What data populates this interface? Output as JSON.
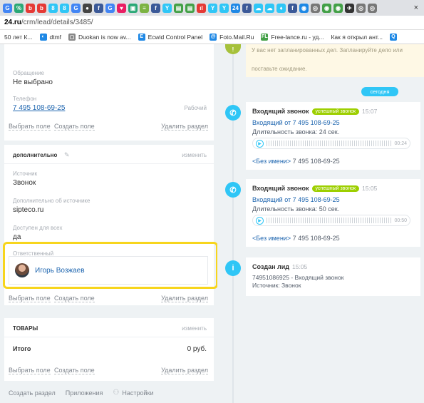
{
  "browser": {
    "tab_favicons": [
      {
        "glyph": "G",
        "color": "#4285f4"
      },
      {
        "glyph": "%",
        "color": "#2aa876"
      },
      {
        "glyph": "b",
        "color": "#e53935"
      },
      {
        "glyph": "b",
        "color": "#e53935"
      },
      {
        "glyph": "8",
        "color": "#2fc6f6"
      },
      {
        "glyph": "8",
        "color": "#2fc6f6"
      },
      {
        "glyph": "G",
        "color": "#4285f4"
      },
      {
        "glyph": "●",
        "color": "#444"
      },
      {
        "glyph": "f",
        "color": "#3b5998"
      },
      {
        "glyph": "G",
        "color": "#4285f4"
      },
      {
        "glyph": "♥",
        "color": "#e91e63"
      },
      {
        "glyph": "▣",
        "color": "#2aa876"
      },
      {
        "glyph": "≡",
        "color": "#7cb342"
      },
      {
        "glyph": "f",
        "color": "#3b5998"
      },
      {
        "glyph": "Y",
        "color": "#2fc6f6"
      },
      {
        "glyph": "▤",
        "color": "#43a047"
      },
      {
        "glyph": "▤",
        "color": "#43a047"
      },
      {
        "glyph": "ıl",
        "color": "#e53935"
      },
      {
        "glyph": "Y",
        "color": "#2fc6f6"
      },
      {
        "glyph": "Y",
        "color": "#2fc6f6"
      },
      {
        "glyph": "24",
        "color": "#1e88e5"
      },
      {
        "glyph": "f",
        "color": "#3b5998"
      },
      {
        "glyph": "☁",
        "color": "#2fc6f6"
      },
      {
        "glyph": "☁",
        "color": "#2fc6f6"
      },
      {
        "glyph": "♦",
        "color": "#2fc6f6"
      },
      {
        "glyph": "f",
        "color": "#3b5998"
      },
      {
        "glyph": "◉",
        "color": "#1e88e5"
      },
      {
        "glyph": "◎",
        "color": "#777"
      },
      {
        "glyph": "◉",
        "color": "#43a047"
      },
      {
        "glyph": "◉",
        "color": "#43a047"
      },
      {
        "glyph": "✈",
        "color": "#333"
      },
      {
        "glyph": "◎",
        "color": "#777"
      },
      {
        "glyph": "◎",
        "color": "#777"
      }
    ],
    "tab_close": "×",
    "url_host": "24.ru",
    "url_path": "/crm/lead/details/3485/",
    "bookmarks": [
      {
        "label": "50 лет К...",
        "icon": "",
        "color": ""
      },
      {
        "label": "dtmf",
        "icon": "◐",
        "color": "#1e88e5"
      },
      {
        "label": "Duokan is now av...",
        "icon": "▢",
        "color": "#888"
      },
      {
        "label": "Ecwid Control Panel",
        "icon": "E",
        "color": "#1e88e5"
      },
      {
        "label": "Foto.Mail.Ru",
        "icon": "@",
        "color": "#1e88e5"
      },
      {
        "label": "Free-lance.ru - уд...",
        "icon": "FL",
        "color": "#43a047"
      },
      {
        "label": "Как я открыл ант...",
        "icon": "",
        "color": ""
      },
      {
        "label": "",
        "icon": "Q",
        "color": "#1e88e5"
      }
    ]
  },
  "lead": {
    "contact": {
      "appeal_label": "Обращение",
      "appeal_value": "Не выбрано",
      "phone_label": "Телефон",
      "phone_value": "7 495 108-69-25",
      "phone_type": "Рабочий",
      "select_field": "Выбрать поле",
      "create_field": "Создать поле",
      "delete_section": "Удалить раздел"
    },
    "additional": {
      "title": "дополнительно",
      "edit": "изменить",
      "source_label": "Источник",
      "source_value": "Звонок",
      "source_info_label": "Дополнительно об источнике",
      "source_info_value": "sipteco.ru",
      "shared_label": "Доступен для всех",
      "shared_value": "да",
      "responsible_label": "Ответственный",
      "responsible_name": "Игорь Возжаев",
      "select_field": "Выбрать поле",
      "create_field": "Создать поле",
      "delete_section": "Удалить раздел"
    },
    "products": {
      "title": "товары",
      "edit": "изменить",
      "total_label": "Итого",
      "total_value": "0 руб.",
      "select_field": "Выбрать поле",
      "create_field": "Создать поле",
      "delete_section": "Удалить раздел"
    },
    "footer": {
      "create_section": "Создать раздел",
      "apps": "Приложения",
      "settings": "Настройки"
    }
  },
  "timeline": {
    "pending_text_1": "У вас нет запланированных дел. Запланируйте дело или",
    "pending_text_2": "поставьте ожидание.",
    "today": "сегодня",
    "calls": [
      {
        "title": "Входящий звонок",
        "status": "успешный звонок",
        "time": "15:07",
        "from": "Входящий от 7 495 108-69-25",
        "duration": "Длительность звонка: 24 сек.",
        "player_time": "00:24",
        "caller": "<Без имени>",
        "caller_phone": "7 495 108-69-25"
      },
      {
        "title": "Входящий звонок",
        "status": "успешный звонок",
        "time": "15:05",
        "from": "Входящий от 7 495 108-69-25",
        "duration": "Длительность звонка: 50 сек.",
        "player_time": "00:50",
        "caller": "<Без имени>",
        "caller_phone": "7 495 108-69-25"
      }
    ],
    "created": {
      "title": "Создан лид",
      "time": "15:05",
      "line1": "74951086925 - Входящий звонок",
      "line2": "Источник: Звонок"
    }
  },
  "colors": {
    "accent": "#2fc6f6",
    "link": "#2067b0",
    "success": "#9dcf00",
    "highlight": "#f7d51d"
  }
}
